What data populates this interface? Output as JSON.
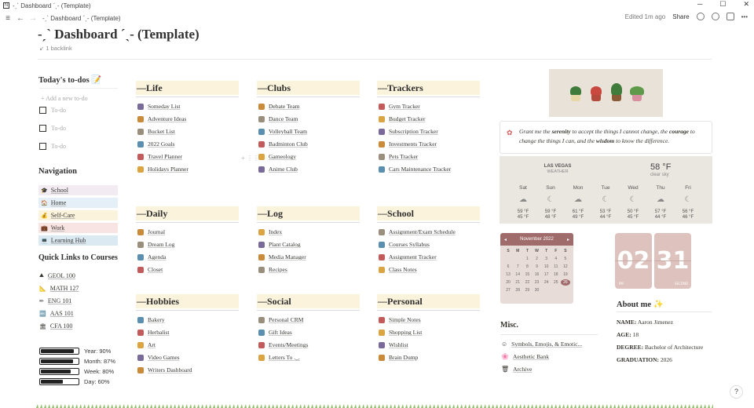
{
  "window": {
    "title": "-ˏˋ Dashboard ˊˎ- (Template)",
    "min": "─",
    "max": "☐",
    "close": "✕"
  },
  "toolbar": {
    "breadcrumb": "-ˏˋ Dashboard ˊˎ- (Template)",
    "edited": "Edited 1m ago",
    "share": "Share"
  },
  "page": {
    "title": "-ˏˋ Dashboard ˊˎ- (Template)",
    "backlink": "↙ 1 backlink"
  },
  "todos": {
    "title": "Today's to-dos 📝",
    "add": "+ Add a new to-do",
    "items": [
      "To-do",
      "To-do",
      "To-do"
    ]
  },
  "navigation": {
    "title": "Navigation",
    "items": [
      {
        "icon": "🎓",
        "label": "School",
        "bg": "#f3ebf2"
      },
      {
        "icon": "🏠",
        "label": "Home",
        "bg": "#e4eff7"
      },
      {
        "icon": "💰",
        "label": "Self-Care",
        "bg": "#fbf3db"
      },
      {
        "icon": "💼",
        "label": "Work",
        "bg": "#f9e4e4"
      },
      {
        "icon": "💻",
        "label": "Learning Hub",
        "bg": "#dbe9f3"
      }
    ]
  },
  "courses": {
    "title": "Quick Links to Courses",
    "items": [
      {
        "icon": "⛰",
        "label": "GEOL 100"
      },
      {
        "icon": "📐",
        "label": "MATH 127"
      },
      {
        "icon": "✏",
        "label": "ENG 101"
      },
      {
        "icon": "🔤",
        "label": "AAS 101"
      },
      {
        "icon": "🏛",
        "label": "CFA 100"
      }
    ]
  },
  "progress": [
    {
      "label": "Year: 90%",
      "value": 90
    },
    {
      "label": "Month: 87%",
      "value": 87
    },
    {
      "label": "Week: 80%",
      "value": 80
    },
    {
      "label": "Day: 60%",
      "value": 60
    }
  ],
  "categories": {
    "life": {
      "title": "—Life",
      "items": [
        "Someday List",
        "Adventure Ideas",
        "Bucket List",
        "2022 Goals",
        "Travel Planner",
        "Holidays Planner"
      ]
    },
    "clubs": {
      "title": "—Clubs",
      "items": [
        "Debate Team",
        "Dance Team",
        "Volleyball Team",
        "Badminton Club",
        "Gameology",
        "Anime Club"
      ]
    },
    "trackers": {
      "title": "—Trackers",
      "items": [
        "Gym Tracker",
        "Budget Tracker",
        "Subscription Tracker",
        "Investments Tracker",
        "Pets Tracker",
        "Cars Maintenance Tracker"
      ]
    },
    "daily": {
      "title": "—Daily",
      "items": [
        "Journal",
        "Dream Log",
        "Agenda",
        "Closet"
      ]
    },
    "log": {
      "title": "—Log",
      "items": [
        "Index",
        "Plant Catalog",
        "Media Manager",
        "Recipes"
      ]
    },
    "school": {
      "title": "—School",
      "items": [
        "Assignment/Exam Schedule",
        "Courses Syllabus",
        "Assignment Tracker",
        "Class Notes"
      ]
    },
    "hobbies": {
      "title": "—Hobbies",
      "items": [
        "Bakery",
        "Herbalist",
        "Art",
        "Video Games",
        "Writers Dashboard"
      ]
    },
    "social": {
      "title": "—Social",
      "items": [
        "Personal CRM",
        "Gift Ideas",
        "Events/Meetings",
        "Letters To ._."
      ]
    },
    "personal": {
      "title": "—Personal",
      "items": [
        "Simple Notes",
        "Shopping List",
        "Wishlist",
        "Brain Dump"
      ]
    }
  },
  "quote": {
    "pre": "Grant me the ",
    "w1": "serenity",
    "mid1": " to accept the things I cannot change, the ",
    "w2": "courage",
    "mid2": " to change the things I can, and the ",
    "w3": "wisdom",
    "post": " to know the difference."
  },
  "weather": {
    "city": "LAS VEGAS",
    "sub": "WEATHER",
    "temp": "58 °F",
    "cond": "clear sky",
    "days": [
      {
        "d": "Sat",
        "hi": "59 °F",
        "lo": "45 °F"
      },
      {
        "d": "Sun",
        "hi": "59 °F",
        "lo": "48 °F"
      },
      {
        "d": "Mon",
        "hi": "61 °F",
        "lo": "49 °F"
      },
      {
        "d": "Tue",
        "hi": "53 °F",
        "lo": "44 °F"
      },
      {
        "d": "Wed",
        "hi": "50 °F",
        "lo": "45 °F"
      },
      {
        "d": "Thu",
        "hi": "57 °F",
        "lo": "44 °F"
      },
      {
        "d": "Fri",
        "hi": "56 °F",
        "lo": "46 °F"
      }
    ]
  },
  "calendar": {
    "month": "November 2022",
    "dow": [
      "S",
      "M",
      "T",
      "W",
      "T",
      "F",
      "S"
    ],
    "cells": [
      "",
      "",
      "1",
      "2",
      "3",
      "4",
      "5",
      "6",
      "7",
      "8",
      "9",
      "10",
      "11",
      "12",
      "13",
      "14",
      "15",
      "16",
      "17",
      "18",
      "19",
      "20",
      "21",
      "22",
      "23",
      "24",
      "25",
      "26",
      "27",
      "28",
      "29",
      "30",
      "",
      "",
      ""
    ],
    "today": "26"
  },
  "clock": {
    "hour": "02",
    "minute": "31",
    "hour_tag": "PM",
    "minute_tag": "SECOND"
  },
  "about": {
    "title": "About me ✨",
    "rows": [
      {
        "k": "NAME:",
        "v": " Aaron Jimenez"
      },
      {
        "k": "AGE:",
        "v": " 18"
      },
      {
        "k": "DEGREE:",
        "v": " Bachelor of Architecture"
      },
      {
        "k": "GRADUATION:",
        "v": " 2026"
      }
    ]
  },
  "misc": {
    "title": "Misc.",
    "items": [
      {
        "icon": "☺",
        "label": "Symbols, Emojis, & Emotic..."
      },
      {
        "icon": "🌸",
        "label": "Aesthetic Bank"
      },
      {
        "icon": "🗑",
        "label": "Archive"
      }
    ]
  },
  "help": "?"
}
